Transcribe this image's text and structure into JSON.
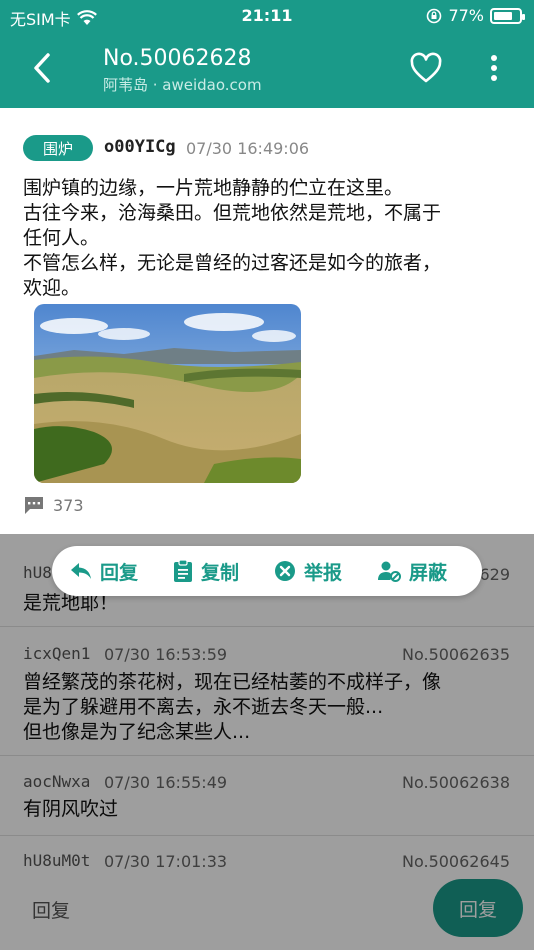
{
  "status_bar": {
    "carrier": "无SIM卡",
    "time": "21:11",
    "battery": "77%",
    "battery_level": 0.77
  },
  "nav": {
    "title": "No.50062628",
    "subtitle": "阿苇岛 · aweidao.com"
  },
  "post": {
    "tag": "围炉",
    "author": "o00YICg",
    "time": "07/30 16:49:06",
    "lines": [
      "围炉镇的边缘，一片荒地静静的伫立在这里。",
      "古往今来，沧海桑田。但荒地依然是荒地，不属于",
      "任何人。",
      "不管怎么样，无论是曾经的过客还是如今的旅者，",
      "欢迎。"
    ],
    "comment_count": "373"
  },
  "replies": [
    {
      "user": "hU8",
      "time": "",
      "no": "629",
      "lines": [
        "是荒地耶！"
      ]
    },
    {
      "user": "icxQen1",
      "time": "07/30 16:53:59",
      "no": "No.50062635",
      "lines": [
        "曾经繁茂的茶花树，现在已经枯萎的不成样子，像",
        "是为了躲避用不离去，永不逝去冬天一般...",
        "但也像是为了纪念某些人..."
      ]
    },
    {
      "user": "aocNwxa",
      "time": "07/30 16:55:49",
      "no": "No.50062638",
      "lines": [
        "有阴风吹过"
      ]
    },
    {
      "user": "hU8uM0t",
      "time": "07/30 17:01:33",
      "no": "No.50062645",
      "lines": []
    }
  ],
  "popup_menu": {
    "reply": "回复",
    "copy": "复制",
    "report": "举报",
    "block": "屏蔽"
  },
  "bottom_bar": {
    "input_placeholder": "回复",
    "send_label": "回复"
  },
  "colors": {
    "accent": "#1a9a89"
  },
  "icons": [
    "back-icon",
    "heart-icon",
    "more-icon",
    "comment-icon",
    "reply-icon",
    "clipboard-icon",
    "report-icon",
    "block-user-icon",
    "wifi-icon",
    "lock-rotation-icon",
    "battery-icon"
  ]
}
